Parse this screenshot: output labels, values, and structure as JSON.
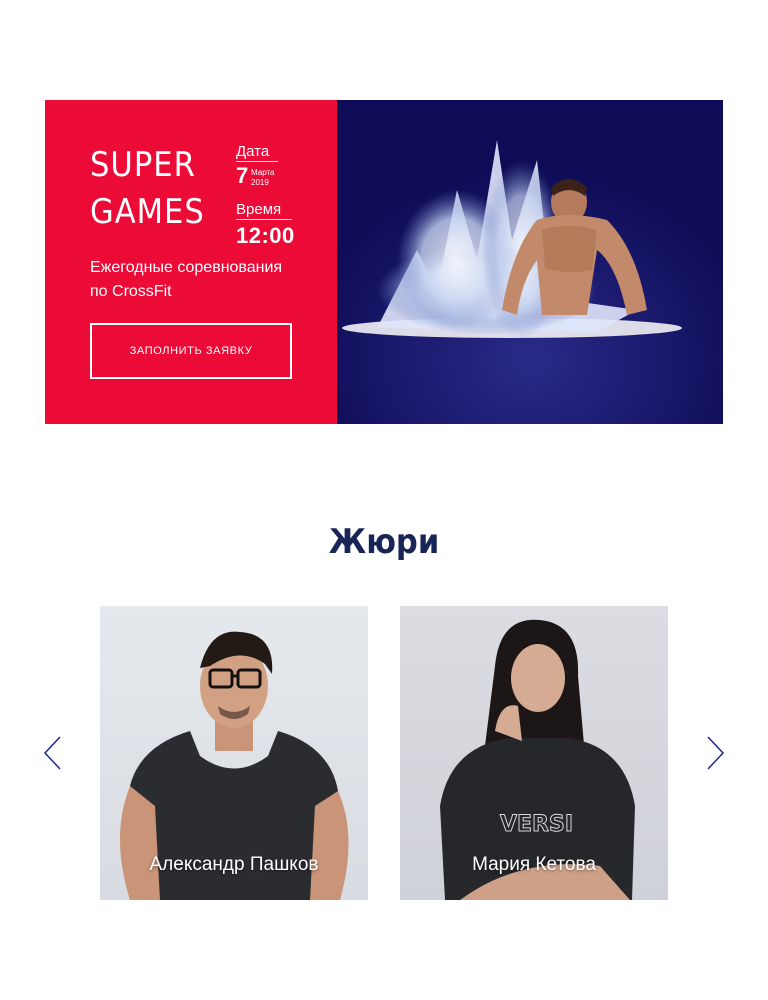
{
  "event": {
    "title": "SUPER\nGAMES",
    "date_label": "Дата",
    "date_day": "7",
    "date_month": "Марта",
    "date_year": "2019",
    "time_label": "Время",
    "time_value": "12:00",
    "subtitle": "Ежегодные соревнования\nпо CrossFit",
    "cta_label": "ЗАПОЛНИТЬ ЗАЯВКУ",
    "colors": {
      "red": "#ec0a37",
      "navy": "#0e0c56"
    }
  },
  "jury": {
    "heading": "Жюри",
    "members": [
      {
        "name": "Александр Пашков"
      },
      {
        "name": "Мария Кетова"
      }
    ],
    "prev_icon": "chevron-left-icon",
    "next_icon": "chevron-right-icon"
  }
}
